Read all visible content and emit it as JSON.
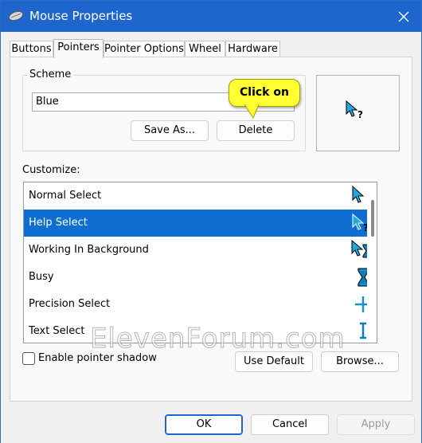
{
  "window": {
    "title": "Mouse Properties"
  },
  "tabs": [
    {
      "label": "Buttons"
    },
    {
      "label": "Pointers"
    },
    {
      "label": "Pointer Options"
    },
    {
      "label": "Wheel"
    },
    {
      "label": "Hardware"
    }
  ],
  "scheme": {
    "label": "Scheme",
    "value": "Blue",
    "save_as_label": "Save As...",
    "delete_label": "Delete"
  },
  "callout": {
    "text": "Click on"
  },
  "customize": {
    "label": "Customize:",
    "items": [
      {
        "label": "Normal Select",
        "icon": "arrow-cursor-icon"
      },
      {
        "label": "Help Select",
        "icon": "help-cursor-icon",
        "selected": true
      },
      {
        "label": "Working In Background",
        "icon": "working-cursor-icon"
      },
      {
        "label": "Busy",
        "icon": "hourglass-icon"
      },
      {
        "label": "Precision Select",
        "icon": "crosshair-icon"
      },
      {
        "label": "Text Select",
        "icon": "text-beam-icon"
      }
    ]
  },
  "options": {
    "enable_shadow_label": "Enable pointer shadow",
    "use_default_label": "Use Default",
    "browse_label": "Browse..."
  },
  "footer": {
    "ok_label": "OK",
    "cancel_label": "Cancel",
    "apply_label": "Apply"
  },
  "watermark": "ElevenForum.com",
  "colors": {
    "titlebar": "#1f66cc",
    "selection": "#0f6fd0",
    "callout": "#ffff33",
    "cursor_blue": "#1fa9e0"
  }
}
